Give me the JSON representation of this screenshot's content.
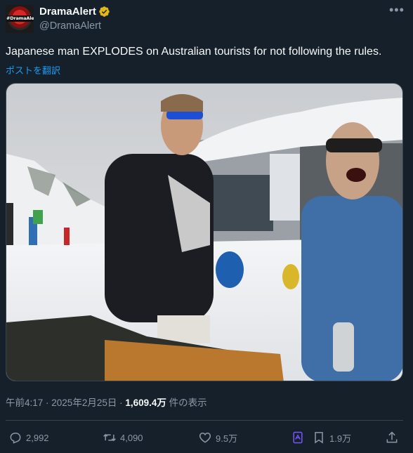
{
  "author": {
    "display_name": "DramaAlert",
    "handle": "@DramaAlert",
    "avatar_text": "#DramaAlert"
  },
  "more_icon": "•••",
  "icons": {
    "verified": "verified-badge-icon",
    "reply": "reply-icon",
    "retweet": "retweet-icon",
    "like": "heart-icon",
    "grok": "grok-icon",
    "bookmark": "bookmark-icon",
    "share": "share-icon"
  },
  "tweet": {
    "text": "Japanese man EXPLODES on Australian tourists for not following the rules.",
    "translate_label": "ポストを翻訳"
  },
  "meta": {
    "time": "午前4:17",
    "separator": " · ",
    "date": "2025年2月25日",
    "views": "1,609.4万",
    "views_label": " 件の表示"
  },
  "actions": {
    "replies": "2,992",
    "retweets": "4,090",
    "likes": "9.5万",
    "bookmarks": "1.9万"
  },
  "colors": {
    "background": "#15202b",
    "accent": "#1d9bf0",
    "muted": "#8b98a5",
    "verified": "#e2b719",
    "grok": "#7856ff"
  }
}
